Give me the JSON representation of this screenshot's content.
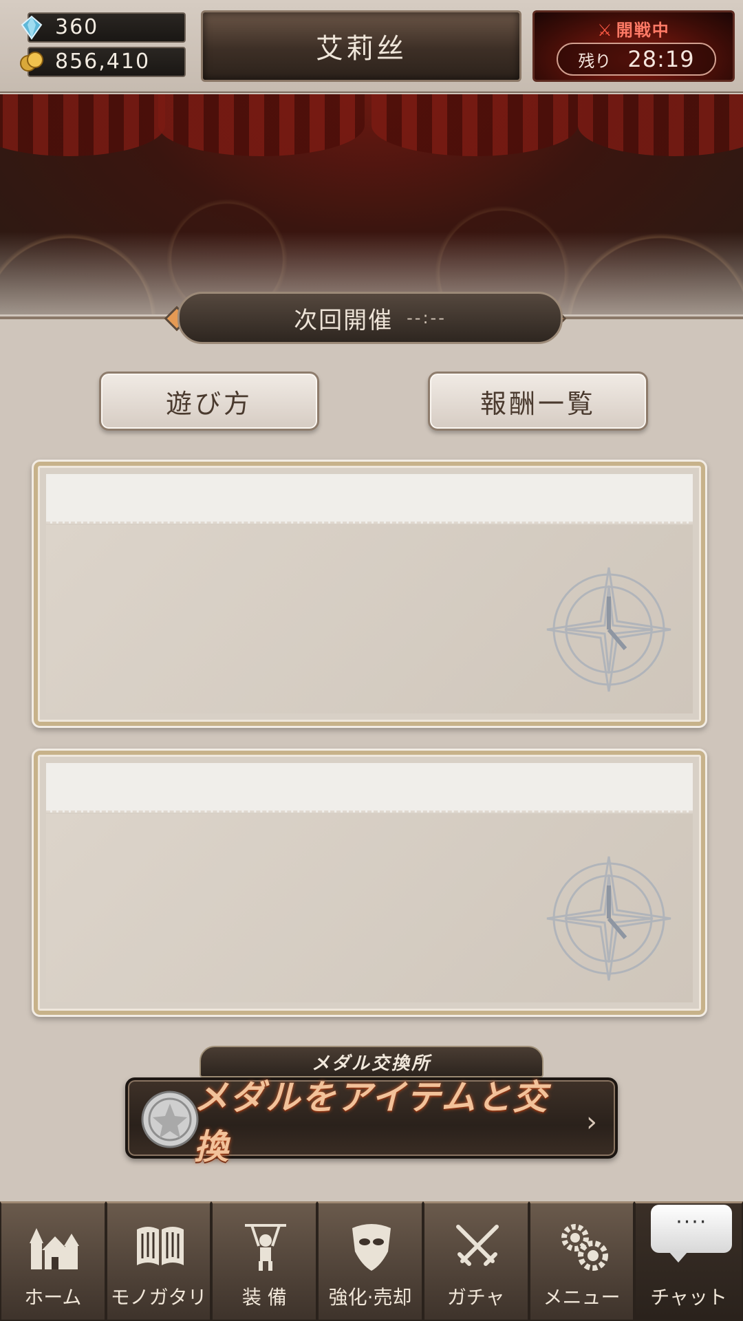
{
  "header": {
    "gems": "360",
    "coins": "856,410",
    "title": "艾莉丝",
    "battle": {
      "status": "開戦中",
      "remaining_label": "残り",
      "remaining_time": "28:19"
    }
  },
  "next_event": {
    "label": "次回開催",
    "value": "--:--"
  },
  "buttons": {
    "how_to_play": "遊び方",
    "rewards_list": "報酬一覧"
  },
  "medal_exchange": {
    "label": "メダル交換所",
    "button_text": "メダルをアイテムと交換"
  },
  "bottom_nav": [
    {
      "label": "ホーム",
      "icon": "home-castle-icon"
    },
    {
      "label": "モノガタリ",
      "icon": "book-icon"
    },
    {
      "label": "装 備",
      "icon": "puppet-icon"
    },
    {
      "label": "強化·売却",
      "icon": "shield-mask-icon"
    },
    {
      "label": "ガチャ",
      "icon": "crossed-swords-icon"
    },
    {
      "label": "メニュー",
      "icon": "gears-icon"
    },
    {
      "label": "チャット",
      "icon": "chat-bubble-icon",
      "bubble": "····"
    }
  ],
  "colors": {
    "battle_red": "#8a1b10",
    "medal_text": "#f2c29a",
    "accent_orange": "#e59a54"
  }
}
